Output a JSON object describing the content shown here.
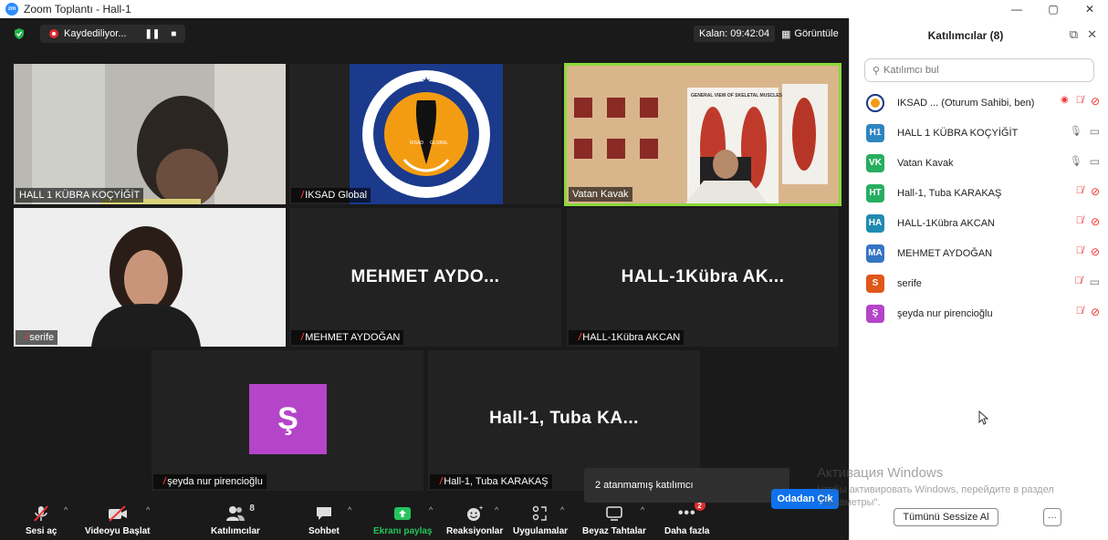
{
  "window": {
    "title": "Zoom Toplantı - Hall-1",
    "logo_text": "zm",
    "controls": [
      "—",
      "▢",
      "✕"
    ]
  },
  "topbar": {
    "recording_label": "Kaydediliyor...",
    "pause_icon": "❚❚",
    "stop_icon": "■",
    "remaining": "Kalan: 09:42:04",
    "view_icon": "▦",
    "view_label": "Görüntüle"
  },
  "tiles": {
    "t1": {
      "name": "HALL 1 KÜBRA KOÇYİĞİT"
    },
    "t2": {
      "name": "IKSAD Global",
      "logo_text": "SOCIAL RESEARCH ★ INSTITUTE OF ECONOMIC DEVELOPMENT AND",
      "logo_inner": "İKSAD GLOBAL"
    },
    "t3": {
      "name": "Vatan Kavak",
      "poster_text": "GENERAL VIEW OF SKELETAL MUSCLES"
    },
    "t4": {
      "name": "serife"
    },
    "t5": {
      "name": "MEHMET AYDOĞAN",
      "big": "MEHMET AYDO..."
    },
    "t6": {
      "name": "HALL-1Kübra AKCAN",
      "big": "HALL-1Kübra AK..."
    },
    "t7": {
      "name": "şeyda nur pirencioğlu",
      "initial": "Ş",
      "initial_color": "#b445c8"
    },
    "t8": {
      "name": "Hall-1, Tuba KARAKAŞ",
      "big": "Hall-1, Tuba KA..."
    }
  },
  "tooltip": "2 atanmamış katılımcı",
  "toolbar": {
    "audio": "Sesi aç",
    "video": "Videoyu Başlat",
    "participants": "Katılımcılar",
    "participants_count": "8",
    "chat": "Sohbet",
    "share": "Ekranı paylaş",
    "reactions": "Reaksiyonlar",
    "apps": "Uygulamalar",
    "whiteboards": "Beyaz Tahtalar",
    "more": "Daha fazla",
    "more_badge": "2",
    "leave": "Odadan Çık",
    "share_color": "#26c45d"
  },
  "panel": {
    "title": "Katılımcılar (8)",
    "search_placeholder": "Katılımcı bul",
    "participants": [
      {
        "initials": "",
        "name": "IKSAD ...  (Oturum Sahibi, ben)",
        "color": "#d98b1a",
        "mic": "muted",
        "cam": "off",
        "rec": true
      },
      {
        "initials": "H1",
        "name": "HALL 1 KÜBRA KOÇYİĞİT",
        "color": "#2e86c1",
        "mic": "on",
        "cam": "on"
      },
      {
        "initials": "VK",
        "name": "Vatan Kavak",
        "color": "#27ae60",
        "mic": "on",
        "cam": "on"
      },
      {
        "initials": "HT",
        "name": "Hall-1, Tuba KARAKAŞ",
        "color": "#27ae60",
        "mic": "muted",
        "cam": "off"
      },
      {
        "initials": "HA",
        "name": "HALL-1Kübra AKCAN",
        "color": "#1f8bb0",
        "mic": "muted",
        "cam": "off"
      },
      {
        "initials": "MA",
        "name": "MEHMET AYDOĞAN",
        "color": "#3574c4",
        "mic": "muted",
        "cam": "off"
      },
      {
        "initials": "S",
        "name": "serife",
        "color": "#e0571a",
        "mic": "muted",
        "cam": "on"
      },
      {
        "initials": "Ş",
        "name": "şeyda nur pirencioğlu",
        "color": "#b445c8",
        "mic": "muted",
        "cam": "off"
      }
    ],
    "mute_all": "Tümünü Sessize Al",
    "more": "···"
  },
  "watermark": {
    "title": "Активация Windows",
    "line": "Чтобы активировать Windows, перейдите в раздел \"Параметры\"."
  }
}
